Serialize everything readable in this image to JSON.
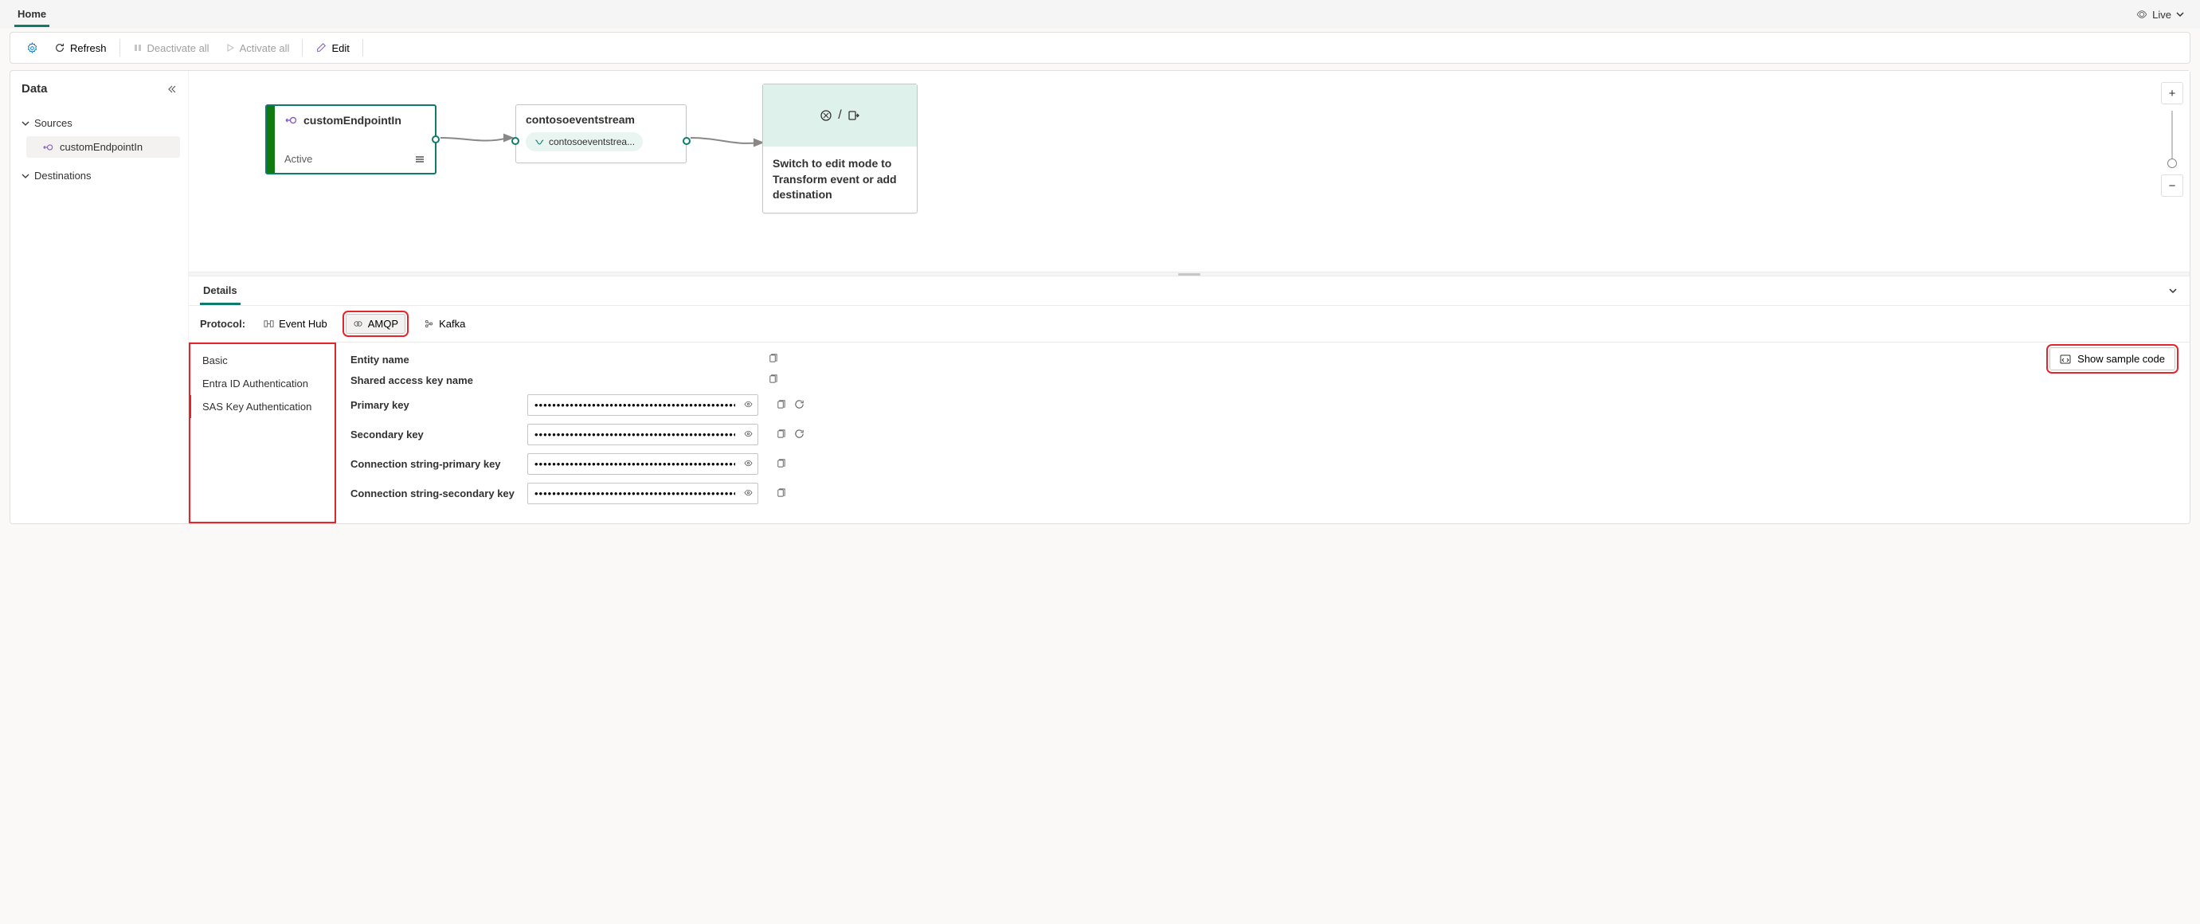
{
  "tabs": {
    "home": "Home"
  },
  "live": {
    "label": "Live"
  },
  "toolbar": {
    "refresh": "Refresh",
    "deactivate_all": "Deactivate all",
    "activate_all": "Activate all",
    "edit": "Edit"
  },
  "sidebar": {
    "title": "Data",
    "sections": {
      "sources": "Sources",
      "destinations": "Destinations"
    },
    "items": {
      "source0": "customEndpointIn"
    }
  },
  "canvas": {
    "source_node": {
      "title": "customEndpointIn",
      "status": "Active"
    },
    "stream_node": {
      "title": "contosoeventstream",
      "chip": "contosoeventstrea..."
    },
    "dest_placeholder": {
      "sep": "/",
      "text": "Switch to edit mode to Transform event or add destination"
    }
  },
  "details": {
    "tab": "Details",
    "protocol_label": "Protocol:",
    "protocols": {
      "eventhub": "Event Hub",
      "amqp": "AMQP",
      "kafka": "Kafka"
    },
    "auth_nav": {
      "basic": "Basic",
      "entra": "Entra ID Authentication",
      "sas": "SAS Key Authentication"
    },
    "sample_btn": "Show sample code",
    "fields": {
      "entity_name": {
        "label": "Entity name",
        "value": ""
      },
      "shared_key_name": {
        "label": "Shared access key name",
        "value": ""
      },
      "primary_key": {
        "label": "Primary key",
        "value": "••••••••••••••••••••••••••••••••••••••••••••••••••••••••••••••"
      },
      "secondary_key": {
        "label": "Secondary key",
        "value": "••••••••••••••••••••••••••••••••••••••••••••••••••••••••••••••"
      },
      "conn_primary": {
        "label": "Connection string-primary key",
        "value": "••••••••••••••••••••••••••••••••••••••••••••••••••••••••••••••"
      },
      "conn_secondary": {
        "label": "Connection string-secondary key",
        "value": "••••••••••••••••••••••••••••••••••••••••••••••••••••••••••••••"
      }
    }
  }
}
